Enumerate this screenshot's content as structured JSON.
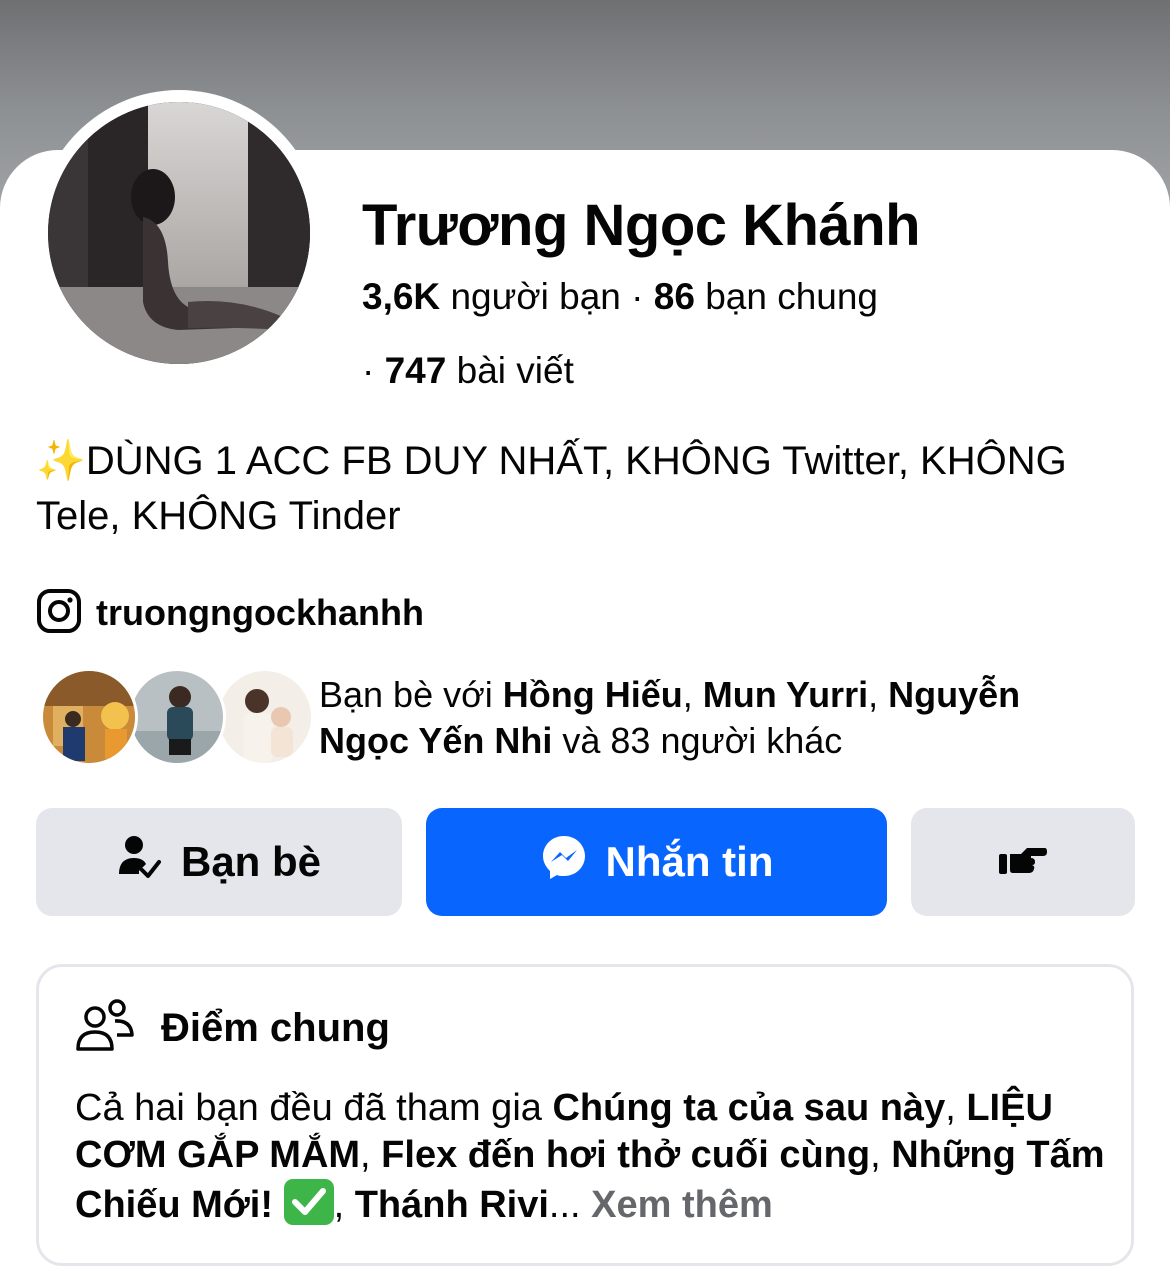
{
  "profile": {
    "name": "Trương Ngọc Khánh",
    "friends_count": "3,6K",
    "friends_label": "người bạn",
    "separator": "·",
    "mutual_count": "86",
    "mutual_label": "bạn chung",
    "posts_count": "747",
    "posts_label": "bài viết"
  },
  "bio": {
    "sparkle": "✨",
    "text": "DÙNG 1 ACC FB DUY NHẤT, KHÔNG Twitter, KHÔNG Tele, KHÔNG Tinder"
  },
  "instagram": {
    "handle": "truongngockhanhh",
    "icon": "instagram-icon"
  },
  "mutual_friends": {
    "prefix": "Bạn bè với ",
    "name1": "Hồng Hiếu",
    "comma1": ", ",
    "name2": "Mun Yurri",
    "comma2": ", ",
    "name3": "Nguyễn Ngọc Yến Nhi",
    "suffix": " và 83 người khác"
  },
  "actions": {
    "friends_label": "Bạn bè",
    "friends_icon": "friend-check-icon",
    "message_label": "Nhắn tin",
    "message_icon": "messenger-icon",
    "more_icon": "poke-hand-icon"
  },
  "common": {
    "title": "Điểm chung",
    "icon": "people-icon",
    "prefix": "Cả hai bạn đều đã tham gia ",
    "group1": "Chúng ta của sau này",
    "sep1": ", ",
    "group2": "LIỆU CƠM GẮP MẮM",
    "sep2": ", ",
    "group3": "Flex đến hơi thở cuối cùng",
    "sep3": ", ",
    "group4": "Những Tấm Chiếu Mới!",
    "sep4": ", ",
    "group5": "Thánh Rivi",
    "ellipsis": "... ",
    "see_more": "Xem thêm"
  },
  "colors": {
    "primary_blue": "#0866ff",
    "button_gray": "#e4e6eb",
    "muted_text": "#65676b"
  }
}
